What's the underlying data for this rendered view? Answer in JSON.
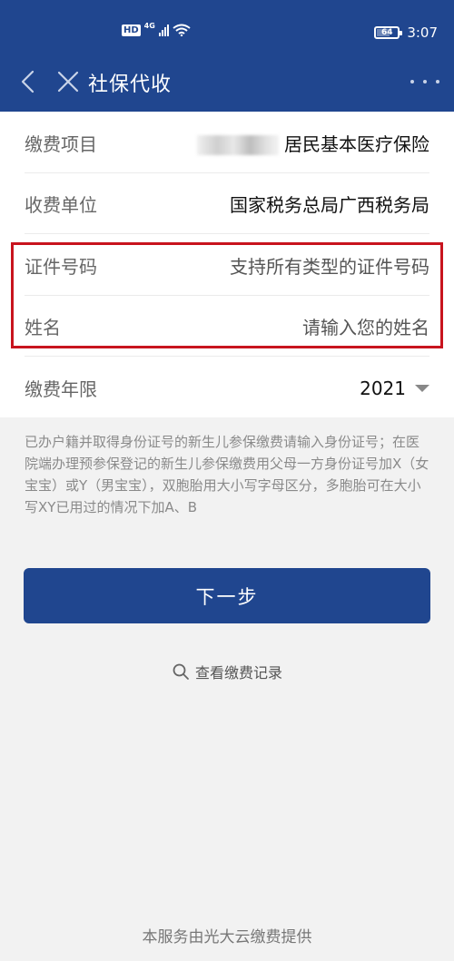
{
  "status_bar": {
    "hd_badge": "HD",
    "network": "4G",
    "battery": "64",
    "battery_level": 0.64,
    "time": "3:07"
  },
  "nav": {
    "title": "社保代收",
    "back_icon": "chevron-left-icon",
    "close_icon": "close-icon",
    "more_icon": "more-dots-icon"
  },
  "form": {
    "rows": [
      {
        "label": "缴费项目",
        "value": "居民基本医疗保险"
      },
      {
        "label": "收费单位",
        "value": "国家税务总局广西税务局"
      },
      {
        "label": "证件号码",
        "placeholder": "支持所有类型的证件号码"
      },
      {
        "label": "姓名",
        "placeholder": "请输入您的姓名"
      },
      {
        "label": "缴费年限",
        "value": "2021"
      }
    ]
  },
  "hint": "已办户籍并取得身份证号的新生儿参保缴费请输入身份证号；在医院端办理预参保登记的新生儿参保缴费用父母一方身份证号加X（女宝宝）或Y（男宝宝），双胞胎用大小写字母区分，多胞胎可在大小写XY已用过的情况下加A、B",
  "actions": {
    "next_label": "下一步",
    "record_label": "查看缴费记录"
  },
  "footer": "本服务由光大云缴费提供",
  "colors": {
    "primary": "#20468f",
    "highlight": "#c8141e",
    "background": "#f2f2f2"
  }
}
